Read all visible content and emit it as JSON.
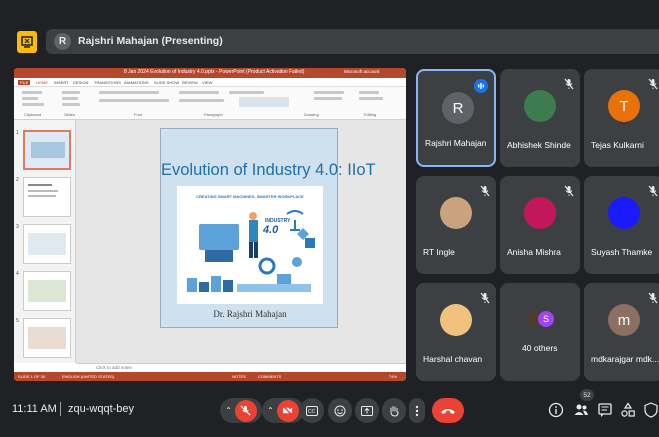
{
  "presenter": {
    "avatar_initial": "R",
    "label": "Rajshri Mahajan (Presenting)"
  },
  "presentation": {
    "window_title": "8 Jan 2024 Evolution of Industry 4.0.pptx - PowerPoint (Product Activation Failed)",
    "user": "Microsoft account",
    "tabs": [
      "FILE",
      "HOME",
      "INSERT",
      "DESIGN",
      "TRANSITIONS",
      "ANIMATIONS",
      "SLIDE SHOW",
      "REVIEW",
      "VIEW"
    ],
    "ribbon_groups": [
      "Clipboard",
      "Slides",
      "Font",
      "Paragraph",
      "Drawing",
      "Editing"
    ],
    "slide_numbers": [
      "1",
      "2",
      "3",
      "4",
      "5"
    ],
    "notes_placeholder": "Click to add notes",
    "status_left": "SLIDE 1 OF 30",
    "status_lang": "ENGLISH (UNITED STATES)",
    "status_notes": "NOTES",
    "status_comments": "COMMENTS",
    "status_zoom": "74%",
    "slide": {
      "title": "Evolution of Industry 4.0: IIoT",
      "image_heading": "CREATING SMART MACHINES, SMARTER WORKPLACE",
      "image_sub1": "INDUSTRY",
      "image_sub2": "4.0",
      "author": "Dr. Rajshri Mahajan"
    }
  },
  "participants": [
    {
      "name": "Rajshri Mahajan",
      "initial": "R",
      "avatar_color": "#5f6368",
      "status": "speaking"
    },
    {
      "name": "Abhishek Shinde",
      "initial": "",
      "avatar_color": "#3e7b4f",
      "status": "muted"
    },
    {
      "name": "Tejas Kulkarni",
      "initial": "T",
      "avatar_color": "#e8710a",
      "status": "muted"
    },
    {
      "name": "RT Ingle",
      "initial": "",
      "avatar_color": "#c9a27e",
      "status": "muted"
    },
    {
      "name": "Anisha Mishra",
      "initial": "",
      "avatar_color": "#c2185b",
      "status": "muted"
    },
    {
      "name": "Suyash Thamke",
      "initial": "",
      "avatar_color": "#1a1aff",
      "status": "muted"
    },
    {
      "name": "Harshal chavan",
      "initial": "",
      "avatar_color": "#f1c27d",
      "status": "muted"
    },
    {
      "name": "40 others",
      "initial": "S",
      "avatar_color": "#a142f4",
      "status": "none"
    },
    {
      "name": "mdkarajgar mdk...",
      "initial": "m",
      "avatar_color": "#8d6e63",
      "status": "muted"
    }
  ],
  "bottombar": {
    "time": "11:11 AM",
    "meeting_code": "zqu-wqqt-bey",
    "participant_count": "52",
    "controls": [
      "mic-off",
      "camera-off",
      "captions",
      "emoji",
      "present",
      "raise-hand",
      "more",
      "leave-call"
    ]
  },
  "colors": {
    "bg": "#202124",
    "tile": "#3c4043",
    "red": "#ea4335",
    "accent": "#8ab4f8",
    "ppt": "#b7472a"
  }
}
